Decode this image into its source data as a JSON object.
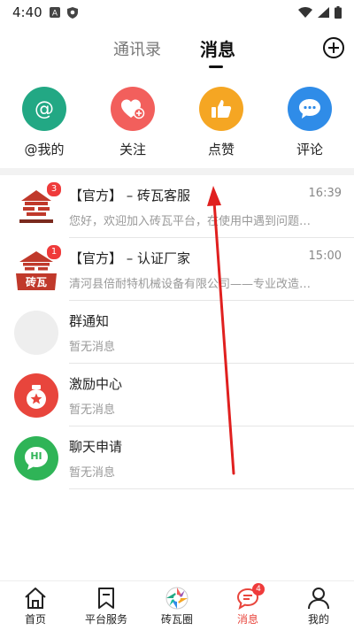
{
  "status_bar": {
    "time": "4:40",
    "icons": [
      "a-notification-icon",
      "shield-icon",
      "wifi-icon",
      "signal-icon",
      "battery-icon"
    ]
  },
  "header": {
    "tabs": [
      {
        "label": "通讯录",
        "active": false
      },
      {
        "label": "消息",
        "active": true
      }
    ],
    "add_icon": "plus-circle-icon"
  },
  "quick_actions": [
    {
      "label": "@我的",
      "icon": "at-icon",
      "color": "#22a884"
    },
    {
      "label": "关注",
      "icon": "heart-plus-icon",
      "color": "#f25f5c"
    },
    {
      "label": "点赞",
      "icon": "thumbs-up-icon",
      "color": "#f5a623"
    },
    {
      "label": "评论",
      "icon": "chat-bubble-icon",
      "color": "#2f8ce8"
    }
  ],
  "messages": [
    {
      "title": "【官方】 – 砖瓦客服",
      "time": "16:39",
      "preview": "您好，欢迎加入砖瓦平台，在使用中遇到问题…",
      "badge": "3",
      "avatar": "brick-logo-avatar"
    },
    {
      "title": "【官方】 – 认证厂家",
      "time": "15:00",
      "preview": "清河县倍耐特机械设备有限公司——专业改造石…",
      "badge": "1",
      "avatar": "brick-tile-logo-avatar",
      "avatar_text": "砖瓦"
    },
    {
      "title": "群通知",
      "time": "",
      "preview": "暂无消息",
      "badge": "",
      "avatar": "group-avatar"
    },
    {
      "title": "激励中心",
      "time": "",
      "preview": "暂无消息",
      "badge": "",
      "avatar": "reward-avatar"
    },
    {
      "title": "聊天申请",
      "time": "",
      "preview": "暂无消息",
      "badge": "",
      "avatar": "hi-avatar",
      "avatar_text": "HI"
    }
  ],
  "bottom_nav": [
    {
      "label": "首页",
      "icon": "home-icon",
      "active": false
    },
    {
      "label": "平台服务",
      "icon": "bookmark-icon",
      "active": false
    },
    {
      "label": "砖瓦圈",
      "icon": "aperture-icon",
      "active": false
    },
    {
      "label": "消息",
      "icon": "message-icon",
      "active": true,
      "badge": "4"
    },
    {
      "label": "我的",
      "icon": "user-icon",
      "active": false
    }
  ],
  "colors": {
    "accent": "#e8453c",
    "badge": "#ef3b3b",
    "arrow": "#e0201f"
  }
}
